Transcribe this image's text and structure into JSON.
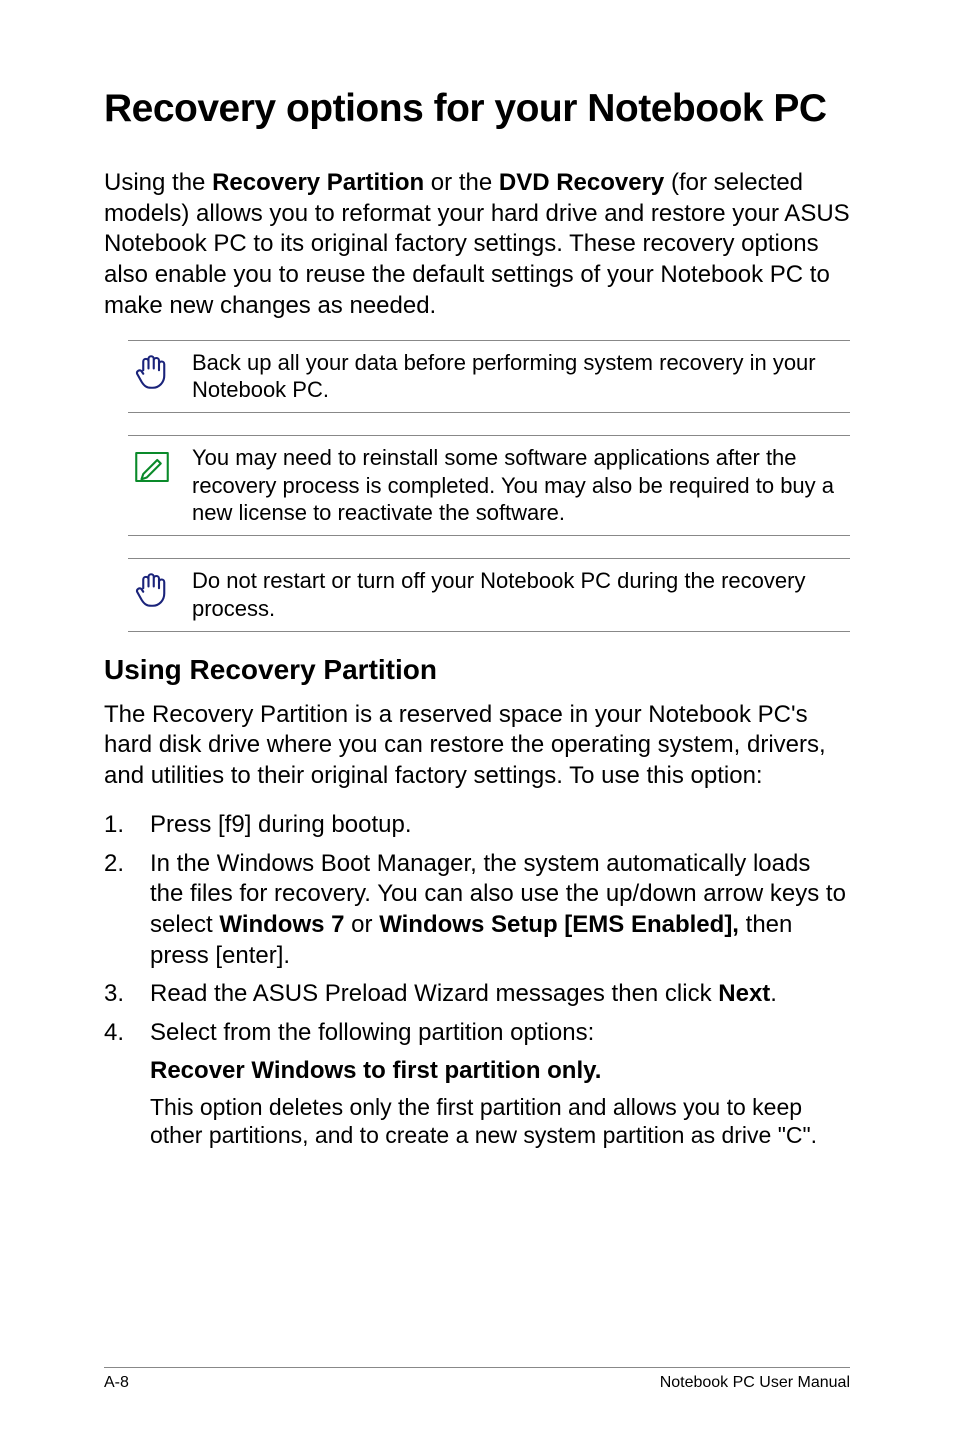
{
  "title": "Recovery options for your Notebook PC",
  "intro_pre": "Using the ",
  "intro_b1": "Recovery Partition",
  "intro_mid": " or the ",
  "intro_b2": "DVD Recovery",
  "intro_post": " (for selected models) allows you to reformat your hard drive and restore your ASUS Notebook PC to its original factory settings. These recovery options also enable you to reuse the default settings of your Notebook PC to make new changes as needed.",
  "note1": "Back up all your data before performing system recovery in your Notebook PC.",
  "note2": "You may need to reinstall some software applications after the recovery process is completed. You may also be required to buy a new license to reactivate the software.",
  "note3": "Do not restart or turn off your Notebook PC during the recovery process.",
  "h2": "Using Recovery Partition",
  "p2": "The Recovery Partition is a reserved space in your Notebook PC's hard disk drive where you can restore the operating system, drivers, and utilities to their original factory settings. To use this option:",
  "step1": "Press [f9] during bootup.",
  "step2_pre": "In the Windows Boot Manager, the system automatically loads the files for recovery. You can also use the up/down arrow keys to select ",
  "step2_b1": "Windows 7",
  "step2_mid": " or ",
  "step2_b2": "Windows Setup [EMS Enabled],",
  "step2_post": " then press [enter].",
  "step3_pre": "Read the ASUS Preload Wizard messages then click ",
  "step3_b": "Next",
  "step3_post": ".",
  "step4": "Select from the following partition options:",
  "sub_heading": "Recover Windows to first partition only.",
  "sub_body": "This option deletes only the first partition and allows you to keep other partitions, and to create a new system partition as drive \"C\".",
  "footer_left": "A-8",
  "footer_right": "Notebook PC User Manual"
}
